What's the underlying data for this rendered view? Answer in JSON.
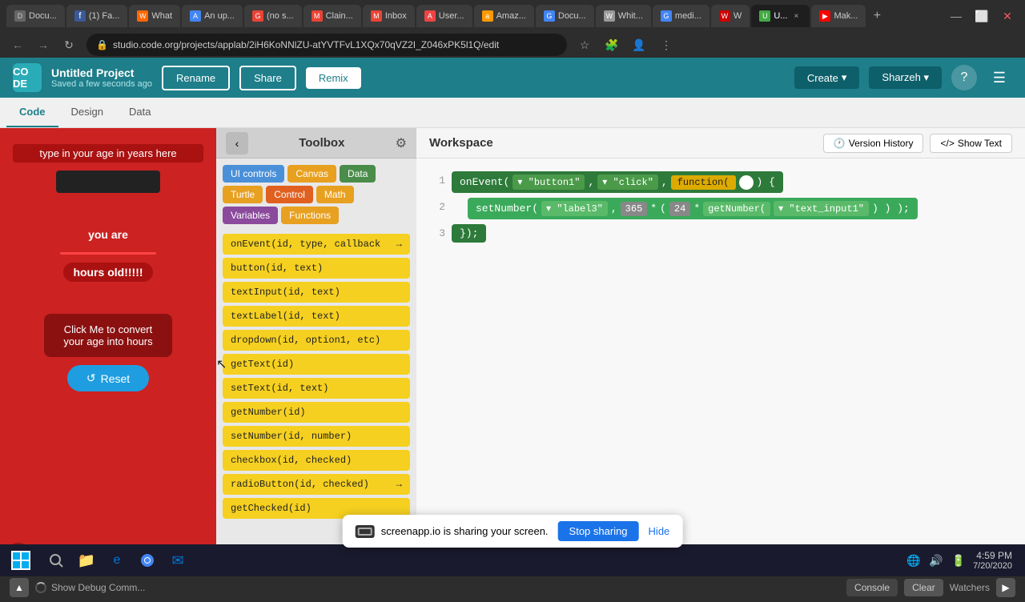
{
  "browser": {
    "tabs": [
      {
        "label": "Docu...",
        "favicon": "D",
        "active": false
      },
      {
        "label": "(1) Fa...",
        "favicon": "f",
        "active": false
      },
      {
        "label": "What...",
        "favicon": "W",
        "active": false
      },
      {
        "label": "An up...",
        "favicon": "A",
        "active": false
      },
      {
        "label": "(no s...",
        "favicon": "G",
        "active": false
      },
      {
        "label": "Clain...",
        "favicon": "M",
        "active": false
      },
      {
        "label": "Inbox",
        "favicon": "G",
        "active": false
      },
      {
        "label": "User...",
        "favicon": "A",
        "active": false
      },
      {
        "label": "Amaz...",
        "favicon": "a",
        "active": false
      },
      {
        "label": "Docu...",
        "favicon": "G",
        "active": false
      },
      {
        "label": "White...",
        "favicon": "W",
        "active": false
      },
      {
        "label": "medi...",
        "favicon": "G",
        "active": false
      },
      {
        "label": "W",
        "favicon": "W",
        "active": false
      },
      {
        "label": "U...",
        "favicon": "U",
        "active": true
      },
      {
        "label": "Mak...",
        "favicon": "Y",
        "active": false
      }
    ],
    "address": "studio.code.org/projects/applab/2iH6KoNNlZU-atYVTFvL1XQx70qVZ2I_Z046xPK5l1Q/edit"
  },
  "app_header": {
    "logo": "CO\nDE",
    "title": "Untitled Project",
    "subtitle": "Saved a few seconds ago",
    "rename_label": "Rename",
    "share_label": "Share",
    "remix_label": "Remix",
    "create_label": "Create",
    "user_label": "Sharzeh",
    "help_label": "?",
    "menu_label": "☰"
  },
  "mode_tabs": {
    "code_label": "Code",
    "design_label": "Design",
    "data_label": "Data"
  },
  "preview": {
    "label_text": "type in your age in years here",
    "you_are_text": "you are",
    "hours_old_text": "hours old!!!!!",
    "convert_btn": "Click Me to convert\nyour age into hours",
    "reset_btn": "Reset"
  },
  "toolbox": {
    "title": "Toolbox",
    "gear_icon": "⚙",
    "back_icon": "‹",
    "categories": [
      {
        "label": "UI controls",
        "class": "cat-ui"
      },
      {
        "label": "Canvas",
        "class": "cat-canvas"
      },
      {
        "label": "Data",
        "class": "cat-data"
      },
      {
        "label": "Turtle",
        "class": "cat-turtle"
      },
      {
        "label": "Control",
        "class": "cat-control"
      },
      {
        "label": "Math",
        "class": "cat-math"
      },
      {
        "label": "Variables",
        "class": "cat-variables"
      },
      {
        "label": "Functions",
        "class": "cat-functions"
      }
    ],
    "blocks": [
      {
        "text": "onEvent(id, type, callback",
        "has_arrow": true
      },
      {
        "text": "button(id, text)",
        "has_arrow": false
      },
      {
        "text": "textInput(id, text)",
        "has_arrow": false
      },
      {
        "text": "textLabel(id, text)",
        "has_arrow": false
      },
      {
        "text": "dropdown(id, option1, etc)",
        "has_arrow": false
      },
      {
        "text": "getText(id)",
        "has_arrow": false
      },
      {
        "text": "setText(id, text)",
        "has_arrow": false
      },
      {
        "text": "getNumber(id)",
        "has_arrow": false
      },
      {
        "text": "setNumber(id, number)",
        "has_arrow": false
      },
      {
        "text": "checkbox(id, checked)",
        "has_arrow": false
      },
      {
        "text": "radioButton(id, checked)",
        "has_arrow": true
      },
      {
        "text": "getChecked(id)",
        "has_arrow": false
      }
    ]
  },
  "workspace": {
    "title": "Workspace",
    "version_history_label": "Version History",
    "show_text_label": "Show Text",
    "code_lines": [
      {
        "num": "1",
        "content": "onEvent(▾ \"button1\", ▾ \"click\", function( ) {"
      },
      {
        "num": "2",
        "content": "setNumber(▾ \"label3\", 365 * (24 * getNumber(▾ \"text_input1\") ) );"
      },
      {
        "num": "3",
        "content": "});"
      }
    ]
  },
  "bottom_bar": {
    "debug_label": "Show Debug Comm...",
    "console_label": "Console",
    "clear_label": "Clear",
    "watchers_label": "Watchers"
  },
  "screen_share": {
    "message": "screenapp.io is sharing your screen.",
    "stop_label": "Stop sharing",
    "hide_label": "Hide"
  },
  "taskbar": {
    "time": "4:59 PM",
    "date": "7/20/2020"
  }
}
